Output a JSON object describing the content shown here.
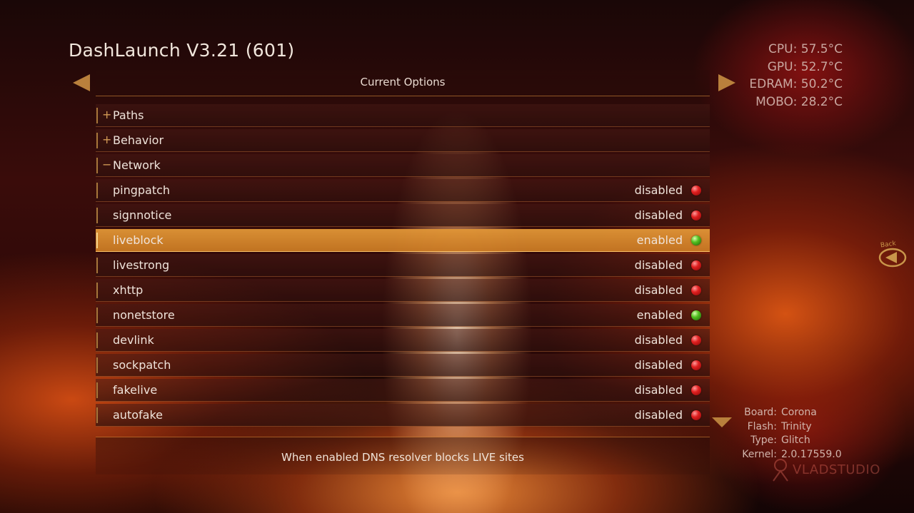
{
  "app": {
    "title": "DashLaunch V3.21 (601)"
  },
  "temperatures": [
    {
      "label": "CPU",
      "value": "57.5°C"
    },
    {
      "label": "GPU",
      "value": "52.7°C"
    },
    {
      "label": "EDRAM",
      "value": "50.2°C"
    },
    {
      "label": "MOBO",
      "value": "28.2°C"
    }
  ],
  "header": {
    "title": "Current Options"
  },
  "sections": [
    {
      "toggle": "+",
      "label": "Paths"
    },
    {
      "toggle": "+",
      "label": "Behavior"
    },
    {
      "toggle": "−",
      "label": "Network"
    }
  ],
  "options": [
    {
      "label": "pingpatch",
      "status": "disabled",
      "indicator": "red"
    },
    {
      "label": "signnotice",
      "status": "disabled",
      "indicator": "red"
    },
    {
      "label": "liveblock",
      "status": "enabled",
      "indicator": "green",
      "selected": true
    },
    {
      "label": "livestrong",
      "status": "disabled",
      "indicator": "red"
    },
    {
      "label": "xhttp",
      "status": "disabled",
      "indicator": "red"
    },
    {
      "label": "nonetstore",
      "status": "enabled",
      "indicator": "green"
    },
    {
      "label": "devlink",
      "status": "disabled",
      "indicator": "red"
    },
    {
      "label": "sockpatch",
      "status": "disabled",
      "indicator": "red"
    },
    {
      "label": "fakelive",
      "status": "disabled",
      "indicator": "red"
    },
    {
      "label": "autofake",
      "status": "disabled",
      "indicator": "red"
    }
  ],
  "footer": {
    "description": "When enabled DNS resolver blocks LIVE sites"
  },
  "back_button": {
    "label": "Back"
  },
  "system_info": [
    {
      "key": "Board:",
      "value": "Corona"
    },
    {
      "key": "Flash:",
      "value": "Trinity"
    },
    {
      "key": "Type:",
      "value": "Glitch"
    },
    {
      "key": "Kernel:",
      "value": "2.0.17559.0"
    }
  ],
  "watermark": {
    "text": "VLADSTUDIO"
  },
  "colors": {
    "accent": "#b9803c",
    "selected_row": "#e0963a",
    "indicator_red": "#e02020",
    "indicator_green": "#52c020"
  }
}
